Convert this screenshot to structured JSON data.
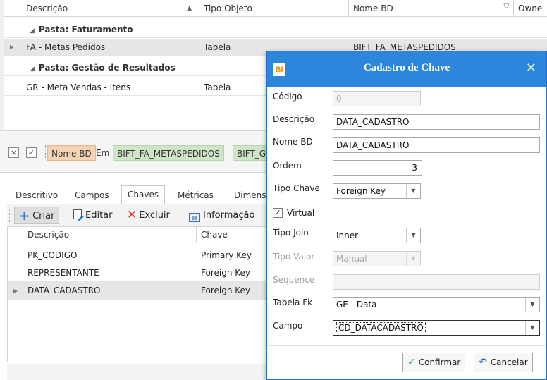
{
  "main_grid": {
    "columns": [
      "Descrição",
      "Tipo Objeto",
      "Nome BD",
      "Owne"
    ],
    "rows": [
      {
        "type": "group",
        "label": "Pasta: Faturamento"
      },
      {
        "type": "row",
        "descricao": "FA - Metas Pedidos",
        "tipo": "Tabela",
        "nome_bd": "BIFT_FA_METASPEDIDOS"
      },
      {
        "type": "group",
        "label": "Pasta: Gestão de Resultados"
      },
      {
        "type": "row",
        "descricao": "GR - Meta Vendas - Itens",
        "tipo": "Tabela",
        "nome_bd": ""
      }
    ]
  },
  "filter_bar": {
    "close_glyph": "×",
    "check_glyph": "✓",
    "field_chip": "Nome BD",
    "operator": "Em",
    "value_chip_1": "BIFT_FA_METASPEDIDOS",
    "value_chip_2": "BIFT_G"
  },
  "tabs": {
    "items": [
      "Descritivo",
      "Campos",
      "Chaves",
      "Métricas",
      "Dimensõ"
    ],
    "active": "Chaves"
  },
  "toolbar": {
    "criar": "Criar",
    "editar": "Editar",
    "excluir": "Excluir",
    "informacao": "Informação"
  },
  "keys_grid": {
    "columns": [
      "Descrição",
      "Chave"
    ],
    "rows": [
      {
        "descricao": "PK_CODIGO",
        "chave": "Primary Key"
      },
      {
        "descricao": "REPRESENTANTE",
        "chave": "Foreign Key"
      },
      {
        "descricao": "DATA_CADASTRO",
        "chave": "Foreign Key"
      }
    ]
  },
  "dialog": {
    "logo": "BI",
    "title": "Cadastro de Chave",
    "close_glyph": "✕",
    "fields": {
      "codigo": {
        "label": "Código",
        "value": "0"
      },
      "descricao": {
        "label": "Descrição",
        "value": "DATA_CADASTRO"
      },
      "nome_bd": {
        "label": "Nome BD",
        "value": "DATA_CADASTRO"
      },
      "ordem": {
        "label": "Ordem",
        "value": "3"
      },
      "tipo_chave": {
        "label": "Tipo Chave",
        "value": "Foreign Key"
      },
      "virtual": {
        "label": "Virtual",
        "checked": true
      },
      "tipo_join": {
        "label": "Tipo Join",
        "value": "Inner"
      },
      "tipo_valor": {
        "label": "Tipo Valor",
        "value": "Manual"
      },
      "sequence": {
        "label": "Sequence",
        "value": ""
      },
      "tabela_fk": {
        "label": "Tabela Fk",
        "value": "GE - Data"
      },
      "campo": {
        "label": "Campo",
        "value": "CD_DATACADASTRO"
      }
    },
    "buttons": {
      "confirmar": "Confirmar",
      "cancelar": "Cancelar"
    }
  },
  "colors": {
    "title_bar": "#2b86dc",
    "chip_orange": "#f6d3b4",
    "chip_green": "#cfe5c8",
    "accent_orange": "#f08a00"
  }
}
